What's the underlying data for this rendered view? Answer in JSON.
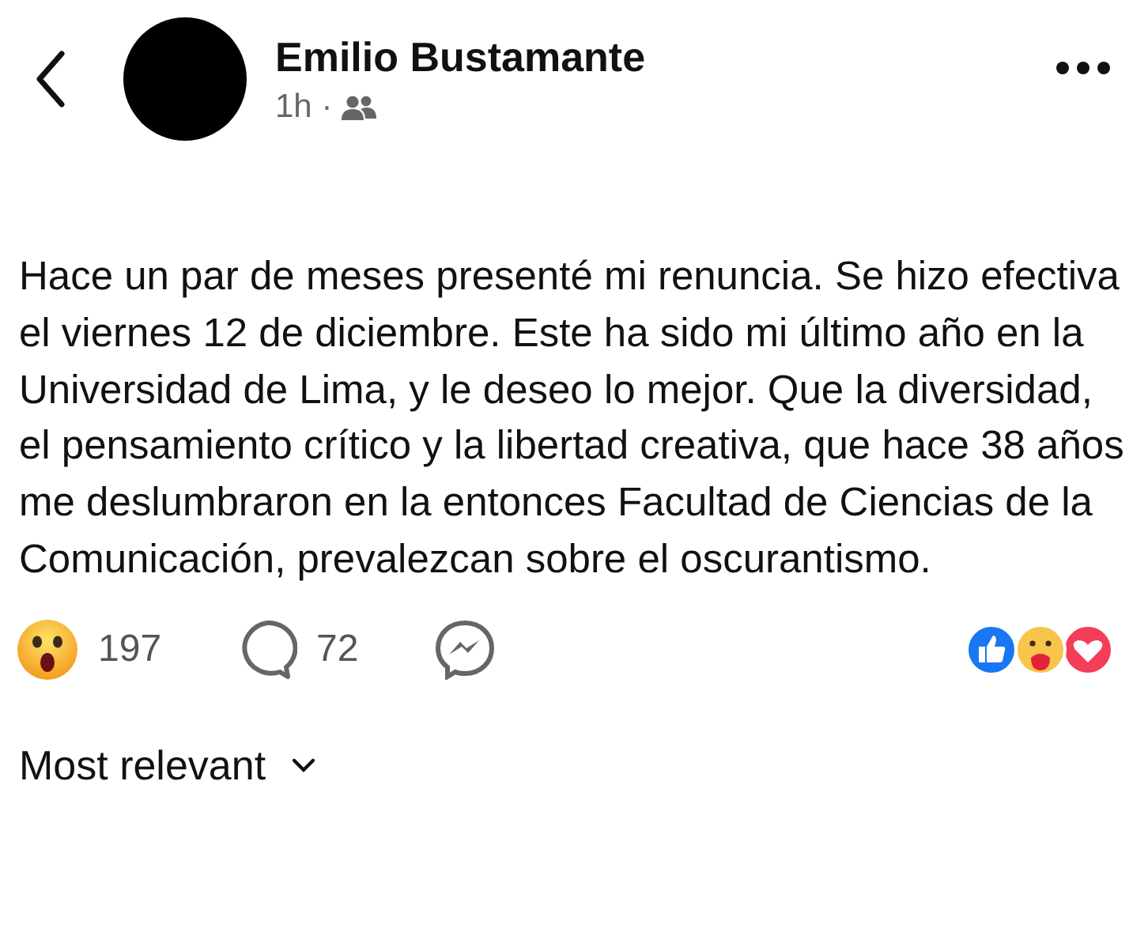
{
  "header": {
    "author": "Emilio Bustamante",
    "time": "1h ·"
  },
  "post": {
    "text": "Hace un par de meses presenté mi renuncia. Se hizo efectiva el viernes 12 de diciembre. Este ha sido mi último año en la Universidad de Lima, y le deseo lo mejor. Que la diversidad, el pensamiento crítico y la libertad creativa, que hace 38 años me deslumbraron en la entonces Facultad de Ciencias de la Comunicación, prevalezcan sobre el oscurantismo."
  },
  "actions": {
    "reactions_count": "197",
    "comments_count": "72"
  },
  "comments": {
    "sort_label": "Most relevant"
  }
}
